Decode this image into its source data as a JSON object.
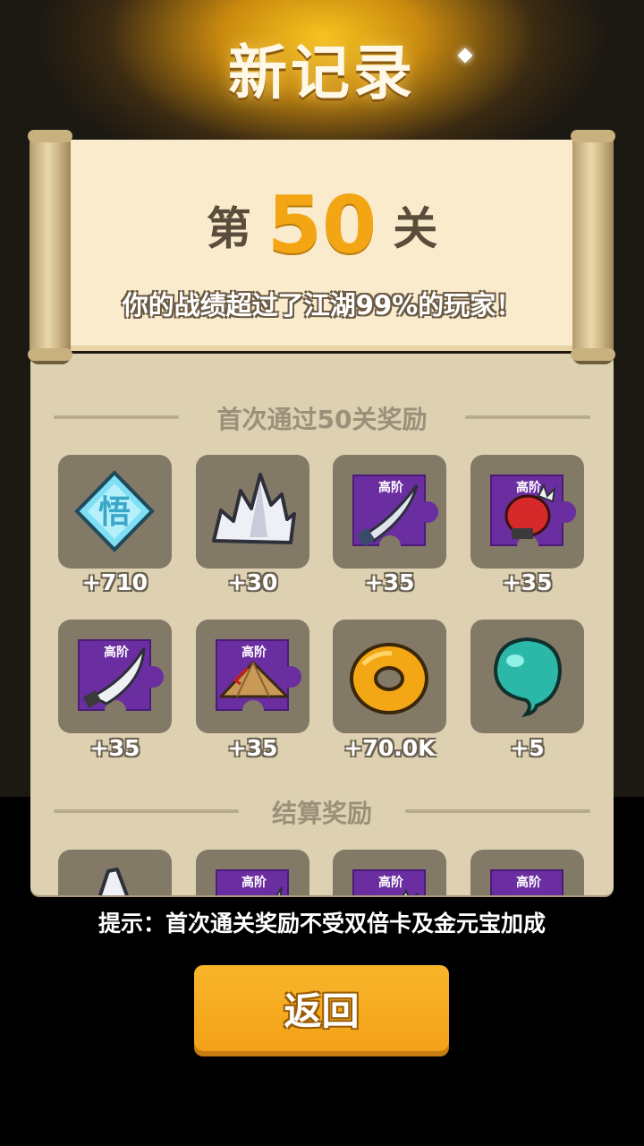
{
  "header": {
    "title": "新记录"
  },
  "scroll": {
    "level_prefix": "第",
    "level_number": "50",
    "level_suffix": "关",
    "description": "你的战绩超过了江湖99%的玩家！"
  },
  "first_clear": {
    "heading": "首次通过50关奖励",
    "rewards": [
      {
        "icon": "enlightenment-crystal-icon",
        "glyph": "悟",
        "count": "+710"
      },
      {
        "icon": "silver-crystal-icon",
        "count": "+30"
      },
      {
        "icon": "saber-fragment-icon",
        "tier": "高阶",
        "count": "+35"
      },
      {
        "icon": "red-gauntlet-fragment-icon",
        "tier": "高阶",
        "count": "+35"
      },
      {
        "icon": "broadsword-fragment-icon",
        "tier": "高阶",
        "count": "+35"
      },
      {
        "icon": "bamboo-hat-fragment-icon",
        "tier": "高阶",
        "count": "+35"
      },
      {
        "icon": "gold-coin-icon",
        "count": "+70.0K"
      },
      {
        "icon": "jade-bead-icon",
        "count": "+5"
      }
    ]
  },
  "settlement": {
    "heading": "结算奖励",
    "rewards": [
      {
        "icon": "silver-crystal-icon"
      },
      {
        "icon": "saber-fragment-icon",
        "tier": "高阶"
      },
      {
        "icon": "red-gauntlet-fragment-icon",
        "tier": "高阶"
      },
      {
        "icon": "broadsword-fragment-icon",
        "tier": "高阶"
      }
    ]
  },
  "footer": {
    "hint": "提示：首次通关奖励不受双倍卡及金元宝加成",
    "back_label": "返回"
  },
  "colors": {
    "accent": "#f3a514",
    "button": "#f9b52a",
    "panel": "#ddd1b2",
    "paper": "#f9ebcc",
    "fragment": "#6a2ea0"
  }
}
